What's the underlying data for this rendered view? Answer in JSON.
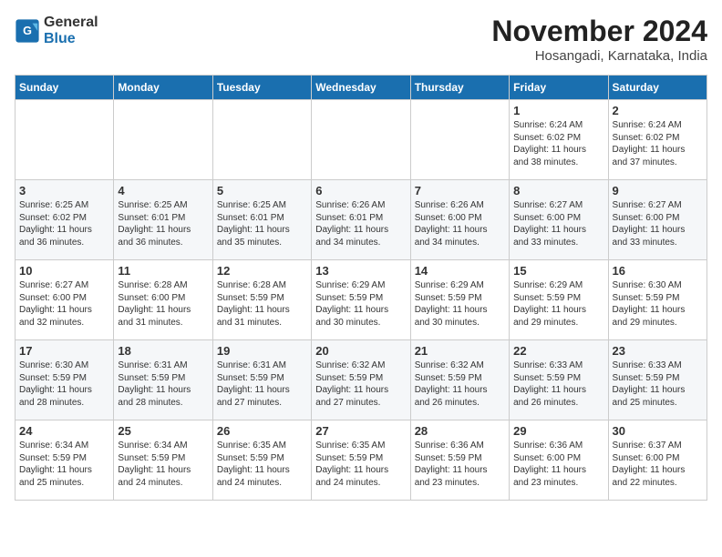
{
  "logo": {
    "line1": "General",
    "line2": "Blue"
  },
  "title": "November 2024",
  "location": "Hosangadi, Karnataka, India",
  "days_of_week": [
    "Sunday",
    "Monday",
    "Tuesday",
    "Wednesday",
    "Thursday",
    "Friday",
    "Saturday"
  ],
  "weeks": [
    [
      {
        "day": "",
        "info": ""
      },
      {
        "day": "",
        "info": ""
      },
      {
        "day": "",
        "info": ""
      },
      {
        "day": "",
        "info": ""
      },
      {
        "day": "",
        "info": ""
      },
      {
        "day": "1",
        "info": "Sunrise: 6:24 AM\nSunset: 6:02 PM\nDaylight: 11 hours\nand 38 minutes."
      },
      {
        "day": "2",
        "info": "Sunrise: 6:24 AM\nSunset: 6:02 PM\nDaylight: 11 hours\nand 37 minutes."
      }
    ],
    [
      {
        "day": "3",
        "info": "Sunrise: 6:25 AM\nSunset: 6:02 PM\nDaylight: 11 hours\nand 36 minutes."
      },
      {
        "day": "4",
        "info": "Sunrise: 6:25 AM\nSunset: 6:01 PM\nDaylight: 11 hours\nand 36 minutes."
      },
      {
        "day": "5",
        "info": "Sunrise: 6:25 AM\nSunset: 6:01 PM\nDaylight: 11 hours\nand 35 minutes."
      },
      {
        "day": "6",
        "info": "Sunrise: 6:26 AM\nSunset: 6:01 PM\nDaylight: 11 hours\nand 34 minutes."
      },
      {
        "day": "7",
        "info": "Sunrise: 6:26 AM\nSunset: 6:00 PM\nDaylight: 11 hours\nand 34 minutes."
      },
      {
        "day": "8",
        "info": "Sunrise: 6:27 AM\nSunset: 6:00 PM\nDaylight: 11 hours\nand 33 minutes."
      },
      {
        "day": "9",
        "info": "Sunrise: 6:27 AM\nSunset: 6:00 PM\nDaylight: 11 hours\nand 33 minutes."
      }
    ],
    [
      {
        "day": "10",
        "info": "Sunrise: 6:27 AM\nSunset: 6:00 PM\nDaylight: 11 hours\nand 32 minutes."
      },
      {
        "day": "11",
        "info": "Sunrise: 6:28 AM\nSunset: 6:00 PM\nDaylight: 11 hours\nand 31 minutes."
      },
      {
        "day": "12",
        "info": "Sunrise: 6:28 AM\nSunset: 5:59 PM\nDaylight: 11 hours\nand 31 minutes."
      },
      {
        "day": "13",
        "info": "Sunrise: 6:29 AM\nSunset: 5:59 PM\nDaylight: 11 hours\nand 30 minutes."
      },
      {
        "day": "14",
        "info": "Sunrise: 6:29 AM\nSunset: 5:59 PM\nDaylight: 11 hours\nand 30 minutes."
      },
      {
        "day": "15",
        "info": "Sunrise: 6:29 AM\nSunset: 5:59 PM\nDaylight: 11 hours\nand 29 minutes."
      },
      {
        "day": "16",
        "info": "Sunrise: 6:30 AM\nSunset: 5:59 PM\nDaylight: 11 hours\nand 29 minutes."
      }
    ],
    [
      {
        "day": "17",
        "info": "Sunrise: 6:30 AM\nSunset: 5:59 PM\nDaylight: 11 hours\nand 28 minutes."
      },
      {
        "day": "18",
        "info": "Sunrise: 6:31 AM\nSunset: 5:59 PM\nDaylight: 11 hours\nand 28 minutes."
      },
      {
        "day": "19",
        "info": "Sunrise: 6:31 AM\nSunset: 5:59 PM\nDaylight: 11 hours\nand 27 minutes."
      },
      {
        "day": "20",
        "info": "Sunrise: 6:32 AM\nSunset: 5:59 PM\nDaylight: 11 hours\nand 27 minutes."
      },
      {
        "day": "21",
        "info": "Sunrise: 6:32 AM\nSunset: 5:59 PM\nDaylight: 11 hours\nand 26 minutes."
      },
      {
        "day": "22",
        "info": "Sunrise: 6:33 AM\nSunset: 5:59 PM\nDaylight: 11 hours\nand 26 minutes."
      },
      {
        "day": "23",
        "info": "Sunrise: 6:33 AM\nSunset: 5:59 PM\nDaylight: 11 hours\nand 25 minutes."
      }
    ],
    [
      {
        "day": "24",
        "info": "Sunrise: 6:34 AM\nSunset: 5:59 PM\nDaylight: 11 hours\nand 25 minutes."
      },
      {
        "day": "25",
        "info": "Sunrise: 6:34 AM\nSunset: 5:59 PM\nDaylight: 11 hours\nand 24 minutes."
      },
      {
        "day": "26",
        "info": "Sunrise: 6:35 AM\nSunset: 5:59 PM\nDaylight: 11 hours\nand 24 minutes."
      },
      {
        "day": "27",
        "info": "Sunrise: 6:35 AM\nSunset: 5:59 PM\nDaylight: 11 hours\nand 24 minutes."
      },
      {
        "day": "28",
        "info": "Sunrise: 6:36 AM\nSunset: 5:59 PM\nDaylight: 11 hours\nand 23 minutes."
      },
      {
        "day": "29",
        "info": "Sunrise: 6:36 AM\nSunset: 6:00 PM\nDaylight: 11 hours\nand 23 minutes."
      },
      {
        "day": "30",
        "info": "Sunrise: 6:37 AM\nSunset: 6:00 PM\nDaylight: 11 hours\nand 22 minutes."
      }
    ]
  ]
}
